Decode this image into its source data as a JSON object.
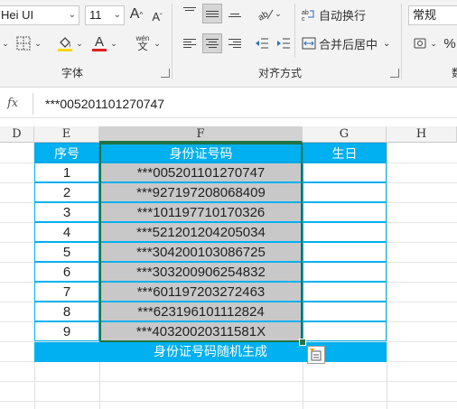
{
  "ribbon": {
    "font_name": "Hei UI",
    "font_size": "11",
    "grow_font": "A",
    "shrink_font": "A",
    "wen_label": "wén",
    "wen_char": "文",
    "font_group_label": "字体",
    "wrap_text": "自动换行",
    "merge_center": "合并后居中",
    "align_group_label": "对齐方式",
    "number_format": "常规",
    "percent": "%",
    "accent_color": "#217346",
    "font_color_bar": "#e02020",
    "fill_color_bar": "#ffd800"
  },
  "formula_bar": {
    "fx": "fx",
    "value": "***005201101270747"
  },
  "columns": [
    "D",
    "E",
    "F",
    "G",
    "H"
  ],
  "table": {
    "headers": [
      "序号",
      "身份证号码",
      "生日"
    ],
    "rows": [
      {
        "num": "1",
        "id": "***005201101270747",
        "birthday": ""
      },
      {
        "num": "2",
        "id": "***927197208068409",
        "birthday": ""
      },
      {
        "num": "3",
        "id": "***101197710170326",
        "birthday": ""
      },
      {
        "num": "4",
        "id": "***521201204205034",
        "birthday": ""
      },
      {
        "num": "5",
        "id": "***304200103086725",
        "birthday": ""
      },
      {
        "num": "6",
        "id": "***303200906254832",
        "birthday": ""
      },
      {
        "num": "7",
        "id": "***601197203272463",
        "birthday": ""
      },
      {
        "num": "8",
        "id": "***623196101112824",
        "birthday": ""
      },
      {
        "num": "9",
        "id": "***40320020311581X",
        "birthday": ""
      }
    ],
    "footer": "身份证号码随机生成",
    "header_color": "#00b0f0",
    "selected_fill": "#c8c8c8"
  }
}
